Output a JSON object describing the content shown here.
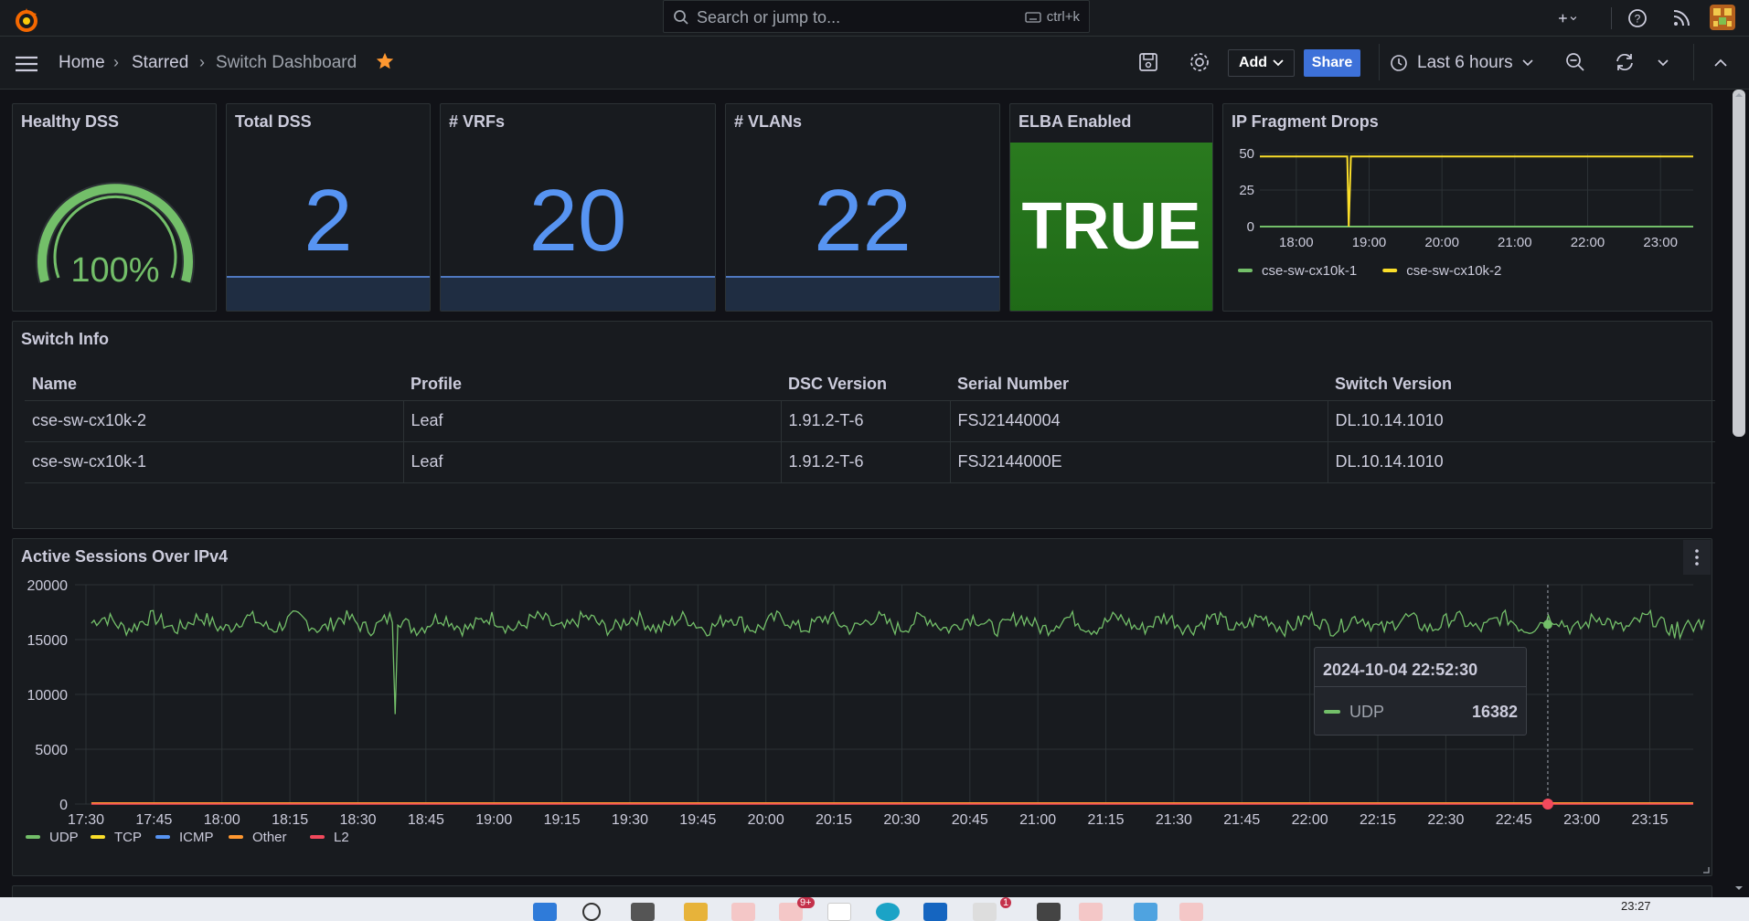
{
  "topbar": {
    "search_placeholder": "Search or jump to...",
    "search_shortcut": "ctrl+k"
  },
  "breadcrumb": {
    "home": "Home",
    "starred": "Starred",
    "current": "Switch Dashboard"
  },
  "toolbar": {
    "add_label": "Add",
    "share_label": "Share",
    "time_range": "Last 6 hours"
  },
  "stats": {
    "healthy_dss": {
      "title": "Healthy DSS",
      "value": "100%",
      "percent": 100
    },
    "total_dss": {
      "title": "Total DSS",
      "value": "2"
    },
    "vrfs": {
      "title": "# VRFs",
      "value": "20"
    },
    "vlans": {
      "title": "# VLANs",
      "value": "22"
    },
    "elba": {
      "title": "ELBA Enabled",
      "value": "TRUE"
    }
  },
  "colors": {
    "udp": "#73bf69",
    "tcp": "#fade2a",
    "icmp": "#5794f2",
    "other": "#ff9830",
    "l2": "#f2495c",
    "stat_blue": "#5794f2",
    "elba_bg": "#2e7d1f"
  },
  "switch_info": {
    "title": "Switch Info",
    "columns": [
      "Name",
      "Profile",
      "DSC Version",
      "Serial Number",
      "Switch Version"
    ],
    "rows": [
      [
        "cse-sw-cx10k-2",
        "Leaf",
        "1.91.2-T-6",
        "FSJ21440004",
        "DL.10.14.1010"
      ],
      [
        "cse-sw-cx10k-1",
        "Leaf",
        "1.91.2-T-6",
        "FSJ2144000E",
        "DL.10.14.1010"
      ]
    ]
  },
  "ip_fragment": {
    "title": "IP Fragment Drops",
    "chart_data": {
      "type": "line",
      "ylim": [
        0,
        50
      ],
      "yticks": [
        "50",
        "25",
        "0"
      ],
      "xticks": [
        "18:00",
        "19:00",
        "20:00",
        "21:00",
        "22:00",
        "23:00"
      ],
      "x_range_hours": [
        17.5,
        23.45
      ],
      "series": [
        {
          "name": "cse-sw-cx10k-1",
          "color": "#73bf69",
          "points": [
            [
              17.5,
              0
            ],
            [
              23.45,
              0
            ]
          ]
        },
        {
          "name": "cse-sw-cx10k-2",
          "color": "#fade2a",
          "points": [
            [
              17.5,
              48
            ],
            [
              18.7,
              48
            ],
            [
              18.72,
              0
            ],
            [
              18.75,
              48
            ],
            [
              23.45,
              48
            ]
          ]
        }
      ]
    }
  },
  "active_sessions": {
    "title": "Active Sessions Over IPv4",
    "tooltip": {
      "time": "2024-10-04 22:52:30",
      "series": "UDP",
      "value": "16382"
    },
    "chart_data": {
      "type": "line",
      "ylim": [
        0,
        20000
      ],
      "yticks": [
        "20000",
        "15000",
        "10000",
        "5000",
        "0"
      ],
      "xticks": [
        "17:30",
        "17:45",
        "18:00",
        "18:15",
        "18:30",
        "18:45",
        "19:00",
        "19:15",
        "19:30",
        "19:45",
        "20:00",
        "20:15",
        "20:30",
        "20:45",
        "21:00",
        "21:15",
        "21:30",
        "21:45",
        "22:00",
        "22:15",
        "22:30",
        "22:45",
        "23:00",
        "23:15"
      ],
      "legend": [
        "UDP",
        "TCP",
        "ICMP",
        "Other",
        "L2"
      ],
      "udp_baseline": 16500,
      "udp_dip": {
        "time": "18:38",
        "value": 8200
      },
      "series": [
        {
          "name": "UDP",
          "color": "#73bf69"
        },
        {
          "name": "TCP",
          "color": "#fade2a"
        },
        {
          "name": "ICMP",
          "color": "#5794f2"
        },
        {
          "name": "Other",
          "color": "#ff9830"
        },
        {
          "name": "L2",
          "color": "#f2495c"
        }
      ]
    }
  },
  "taskbar": {
    "clock": "23:27",
    "badge_1": "9+",
    "badge_2": "1"
  }
}
